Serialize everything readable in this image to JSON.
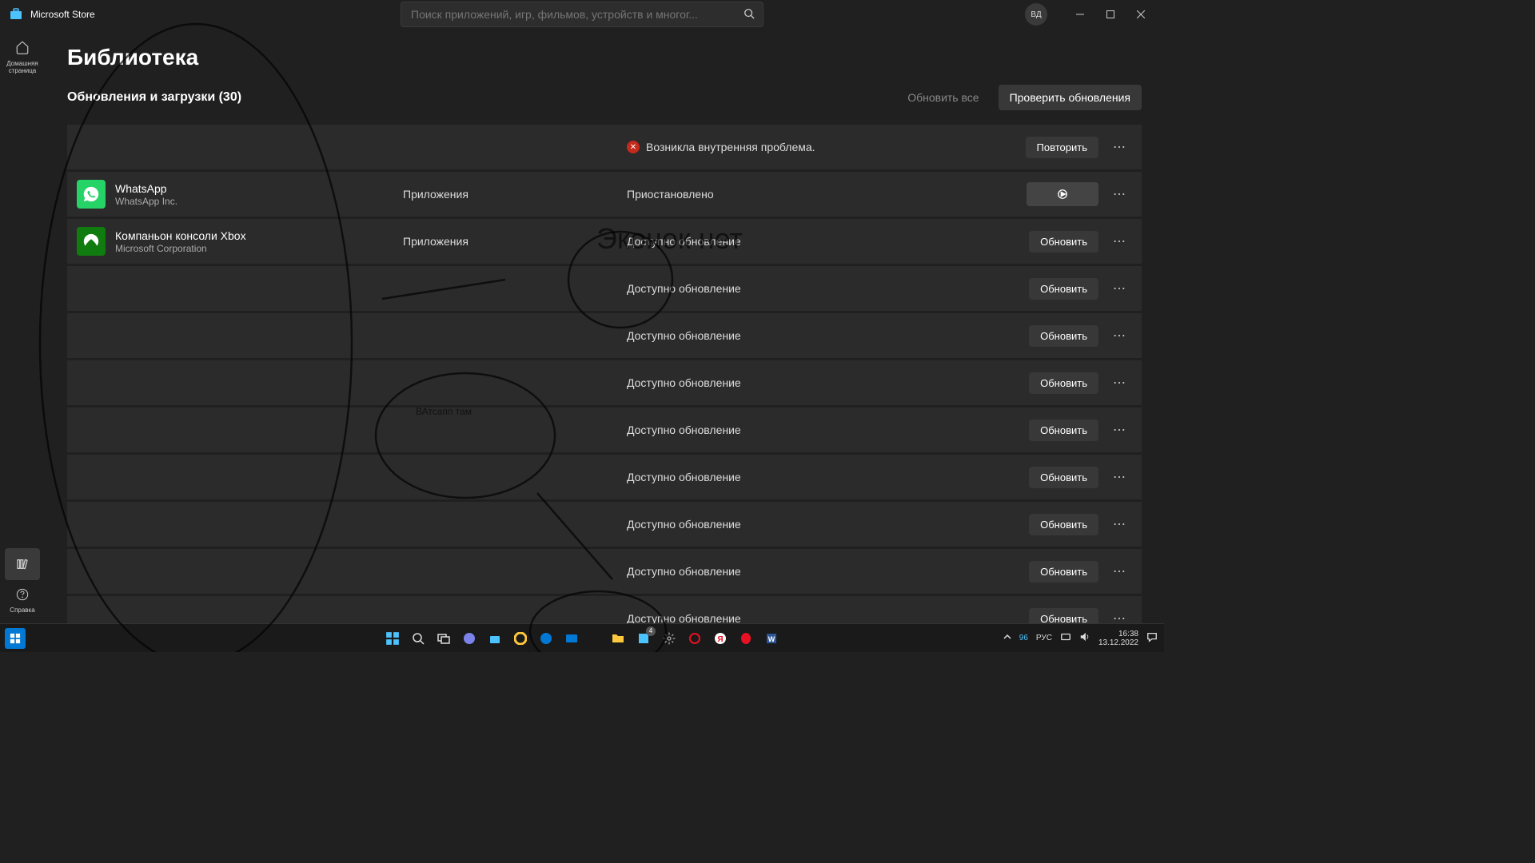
{
  "titlebar": {
    "app_name": "Microsoft Store",
    "search_placeholder": "Поиск приложений, игр, фильмов, устройств и многог...",
    "user_initials": "ВД"
  },
  "sidebar": {
    "home_label": "Домашняя страница",
    "help_label": "Справка"
  },
  "page": {
    "title": "Библиотека",
    "section_title": "Обновления и загрузки (30)",
    "update_all": "Обновить все",
    "check_updates": "Проверить обновления"
  },
  "rows": [
    {
      "name": "",
      "publisher": "",
      "type": "",
      "status": "Возникла внутренняя проблема.",
      "error": true,
      "action": "Повторить",
      "action_type": "button"
    },
    {
      "name": "WhatsApp",
      "publisher": "WhatsApp Inc.",
      "icon": "whatsapp",
      "type": "Приложения",
      "status": "Приостановлено",
      "action_type": "play"
    },
    {
      "name": "Компаньон консоли Xbox",
      "publisher": "Microsoft Corporation",
      "icon": "xbox",
      "type": "Приложения",
      "status": "Доступно обновление",
      "action": "Обновить",
      "action_type": "button"
    },
    {
      "name": "",
      "publisher": "",
      "type": "",
      "status": "Доступно обновление",
      "action": "Обновить",
      "action_type": "button"
    },
    {
      "name": "",
      "publisher": "",
      "type": "",
      "status": "Доступно обновление",
      "action": "Обновить",
      "action_type": "button"
    },
    {
      "name": "",
      "publisher": "",
      "type": "",
      "status": "Доступно обновление",
      "action": "Обновить",
      "action_type": "button"
    },
    {
      "name": "",
      "publisher": "",
      "type": "",
      "status": "Доступно обновление",
      "action": "Обновить",
      "action_type": "button"
    },
    {
      "name": "",
      "publisher": "",
      "type": "",
      "status": "Доступно обновление",
      "action": "Обновить",
      "action_type": "button"
    },
    {
      "name": "",
      "publisher": "",
      "type": "",
      "status": "Доступно обновление",
      "action": "Обновить",
      "action_type": "button"
    },
    {
      "name": "",
      "publisher": "",
      "type": "",
      "status": "Доступно обновление",
      "action": "Обновить",
      "action_type": "button"
    },
    {
      "name": "",
      "publisher": "",
      "type": "",
      "status": "Доступно обновление",
      "action": "Обновить",
      "action_type": "button"
    }
  ],
  "annotations": {
    "big": "Эконок нет",
    "small": "ВАтсапп там"
  },
  "taskbar": {
    "tray_num": "96",
    "lang": "РУС",
    "time": "16:38",
    "date": "13.12.2022",
    "badge": "4"
  }
}
